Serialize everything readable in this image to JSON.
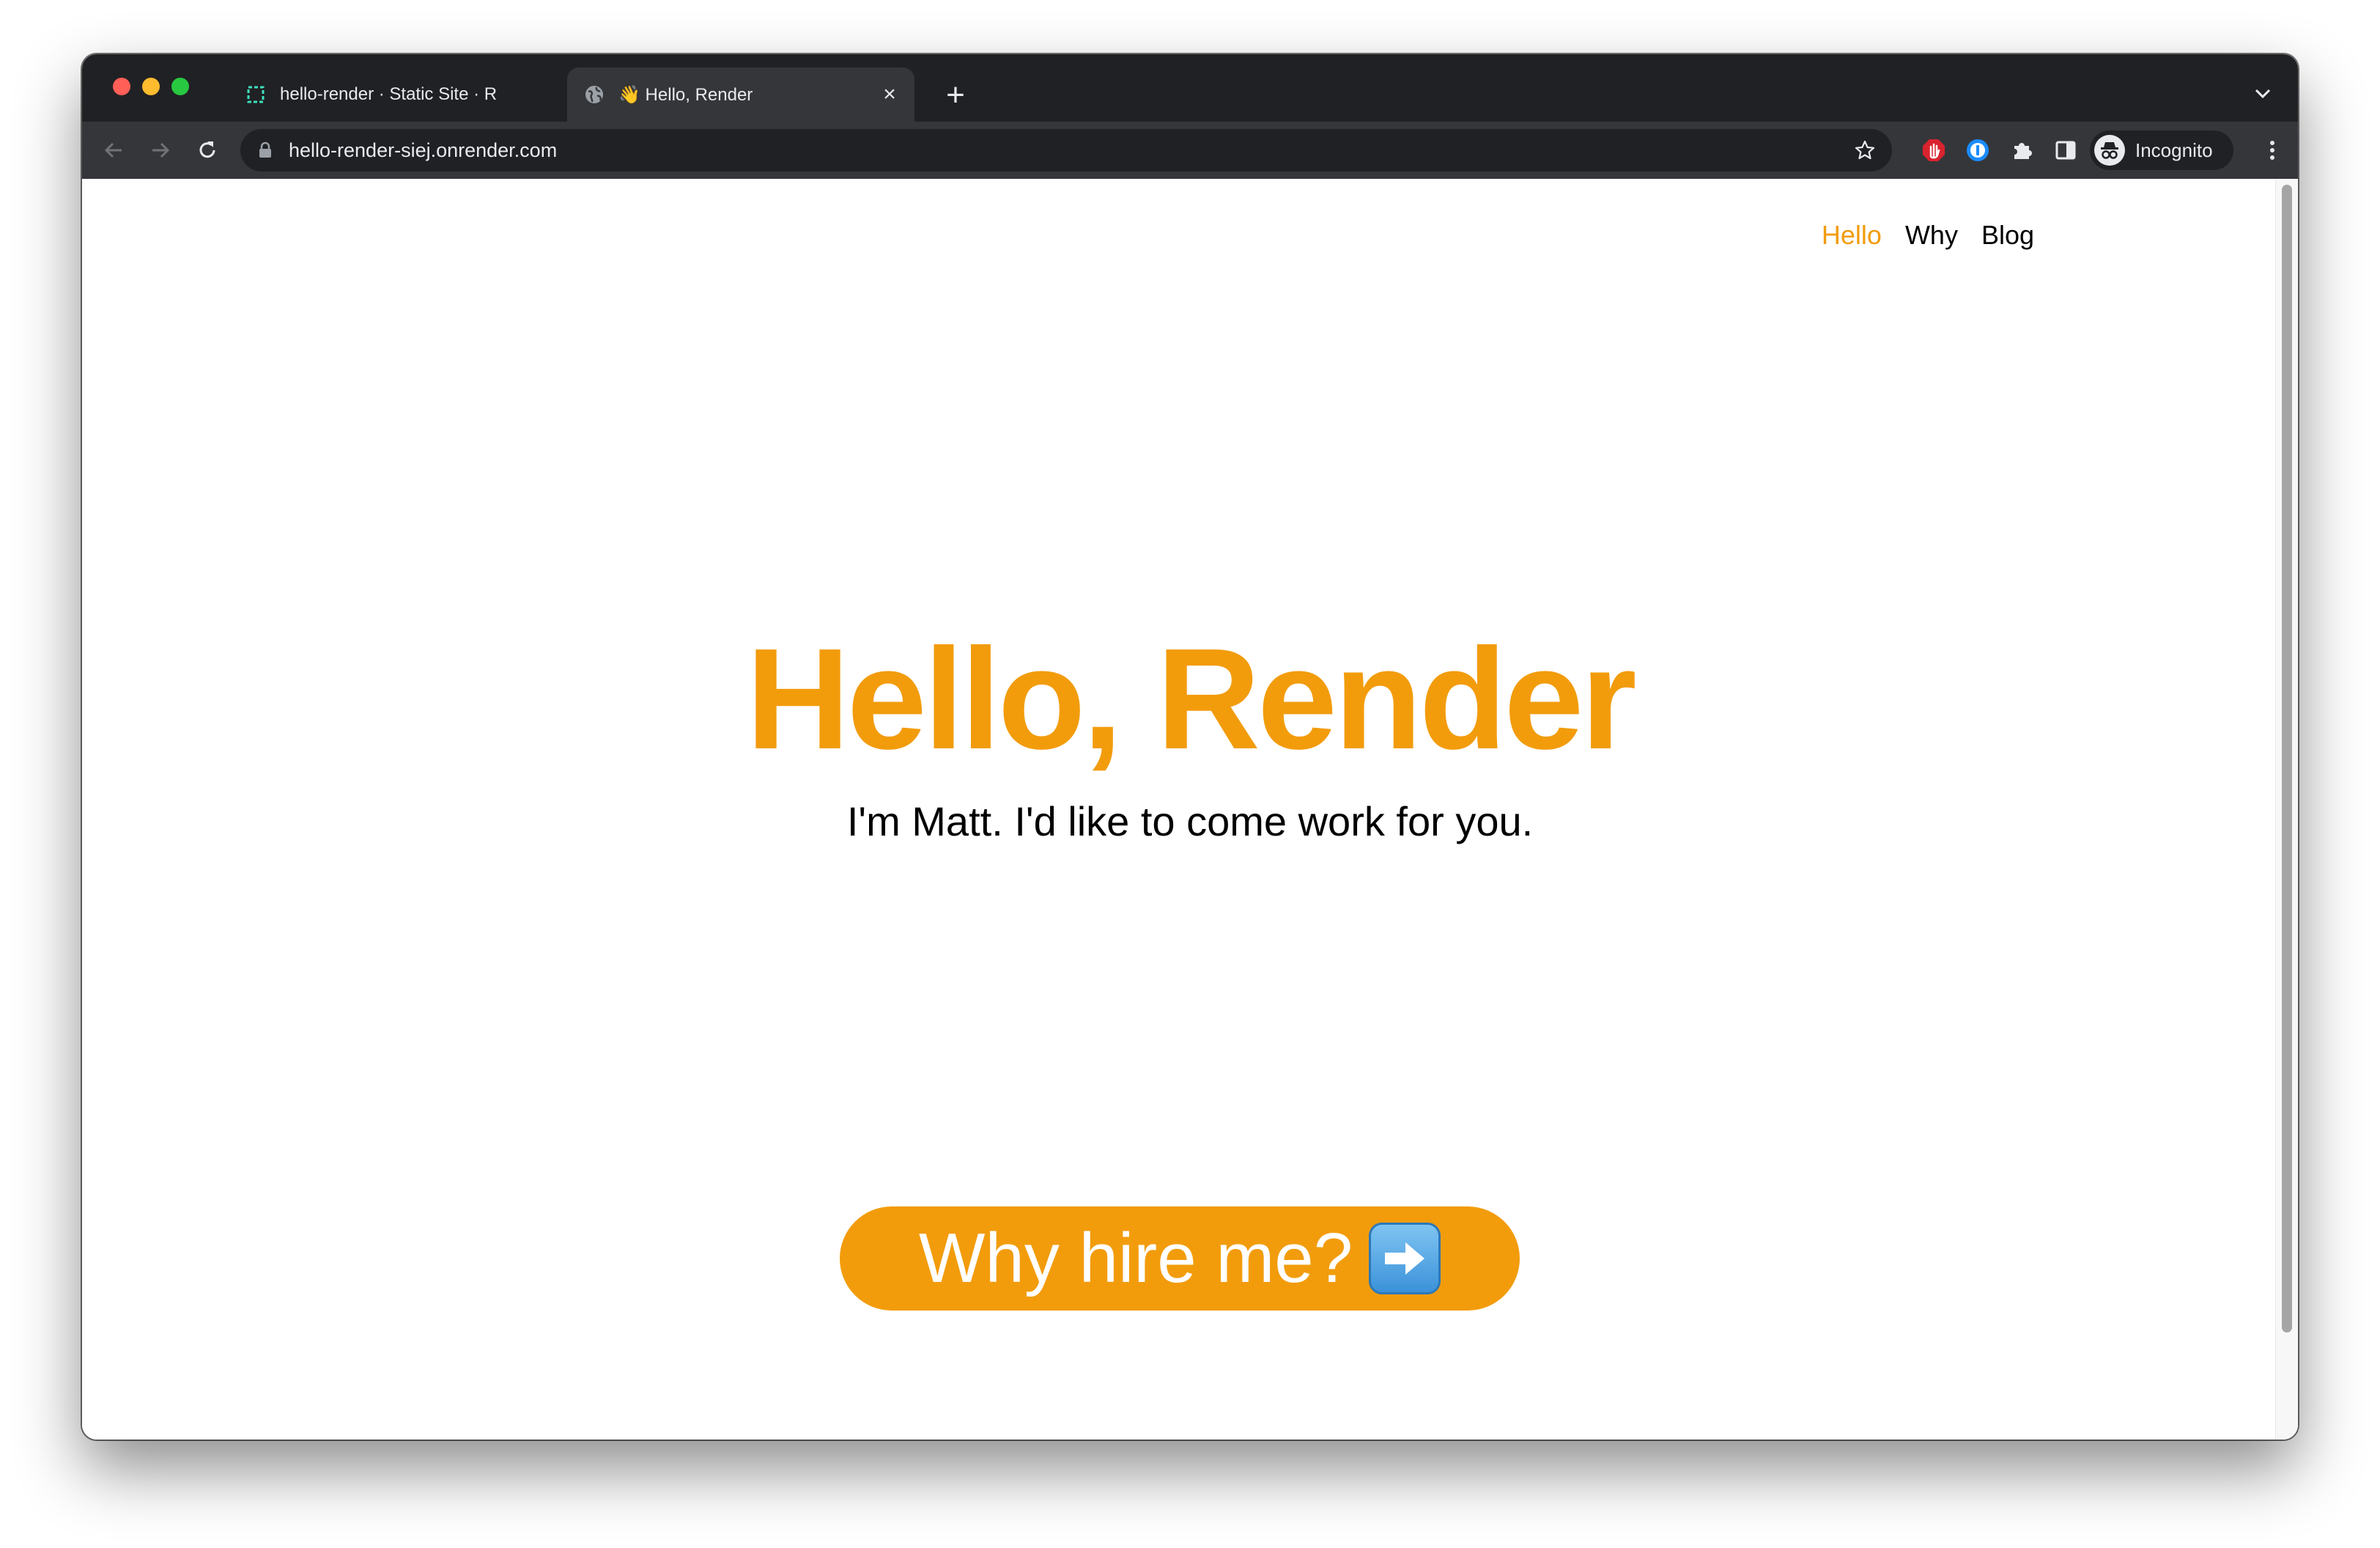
{
  "browser": {
    "tabs": [
      {
        "title": "hello-render · Static Site · R",
        "favicon": "render-dashboard-icon",
        "active": false
      },
      {
        "title": "👋 Hello, Render",
        "favicon": "globe-icon",
        "active": true
      }
    ],
    "url": "hello-render-siej.onrender.com",
    "profile_label": "Incognito",
    "colors": {
      "frame": "#202124",
      "toolbar": "#35363a",
      "text": "#e8eaed"
    }
  },
  "site": {
    "nav": [
      {
        "label": "Hello",
        "active": true
      },
      {
        "label": "Why",
        "active": false
      },
      {
        "label": "Blog",
        "active": false
      }
    ],
    "title": "Hello, Render",
    "subtitle": "I'm Matt. I'd like to come work for you.",
    "cta_label": "Why hire me?",
    "cta_icon": "right-arrow-emoji-icon",
    "colors": {
      "accent": "#f29c0c",
      "text": "#000000",
      "background": "#ffffff"
    }
  }
}
